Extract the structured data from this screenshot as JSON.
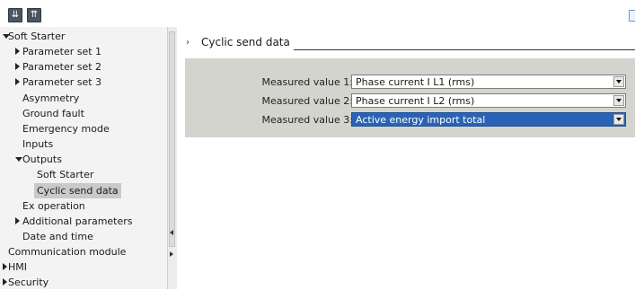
{
  "toolbar": {
    "icons": [
      "collapse-all-icon",
      "expand-all-icon"
    ]
  },
  "tree": {
    "items": [
      {
        "label": "Soft Starter",
        "indent": 0,
        "arrow": "down"
      },
      {
        "label": "Parameter set 1",
        "indent": 1,
        "arrow": "right"
      },
      {
        "label": "Parameter set 2",
        "indent": 1,
        "arrow": "right"
      },
      {
        "label": "Parameter set 3",
        "indent": 1,
        "arrow": "right"
      },
      {
        "label": "Asymmetry",
        "indent": 1,
        "arrow": ""
      },
      {
        "label": "Ground fault",
        "indent": 1,
        "arrow": ""
      },
      {
        "label": "Emergency mode",
        "indent": 1,
        "arrow": ""
      },
      {
        "label": "Inputs",
        "indent": 1,
        "arrow": ""
      },
      {
        "label": "Outputs",
        "indent": 1,
        "arrow": "down"
      },
      {
        "label": "Soft Starter",
        "indent": 2,
        "arrow": ""
      },
      {
        "label": "Cyclic send data",
        "indent": 2,
        "arrow": "",
        "selected": true
      },
      {
        "label": "Ex operation",
        "indent": 1,
        "arrow": ""
      },
      {
        "label": "Additional parameters",
        "indent": 1,
        "arrow": "right"
      },
      {
        "label": "Date and time",
        "indent": 1,
        "arrow": ""
      },
      {
        "label": "Communication module",
        "indent": 0,
        "arrow": ""
      },
      {
        "label": "HMI",
        "indent": 0,
        "arrow": "right"
      },
      {
        "label": "Security",
        "indent": 0,
        "arrow": "right"
      }
    ]
  },
  "section": {
    "chevron": "›",
    "title": "Cyclic send data"
  },
  "fields": [
    {
      "label": "Measured value 1:",
      "value": "Phase current I L1 (rms)",
      "active": false
    },
    {
      "label": "Measured value 2:",
      "value": "Phase current I L2 (rms)",
      "active": false
    },
    {
      "label": "Measured value 3:",
      "value": "Active energy import total",
      "active": true
    }
  ],
  "colors": {
    "panel": "#d4d4ce",
    "selection": "#2a63b5",
    "tree_selected": "#c9c9c9"
  }
}
